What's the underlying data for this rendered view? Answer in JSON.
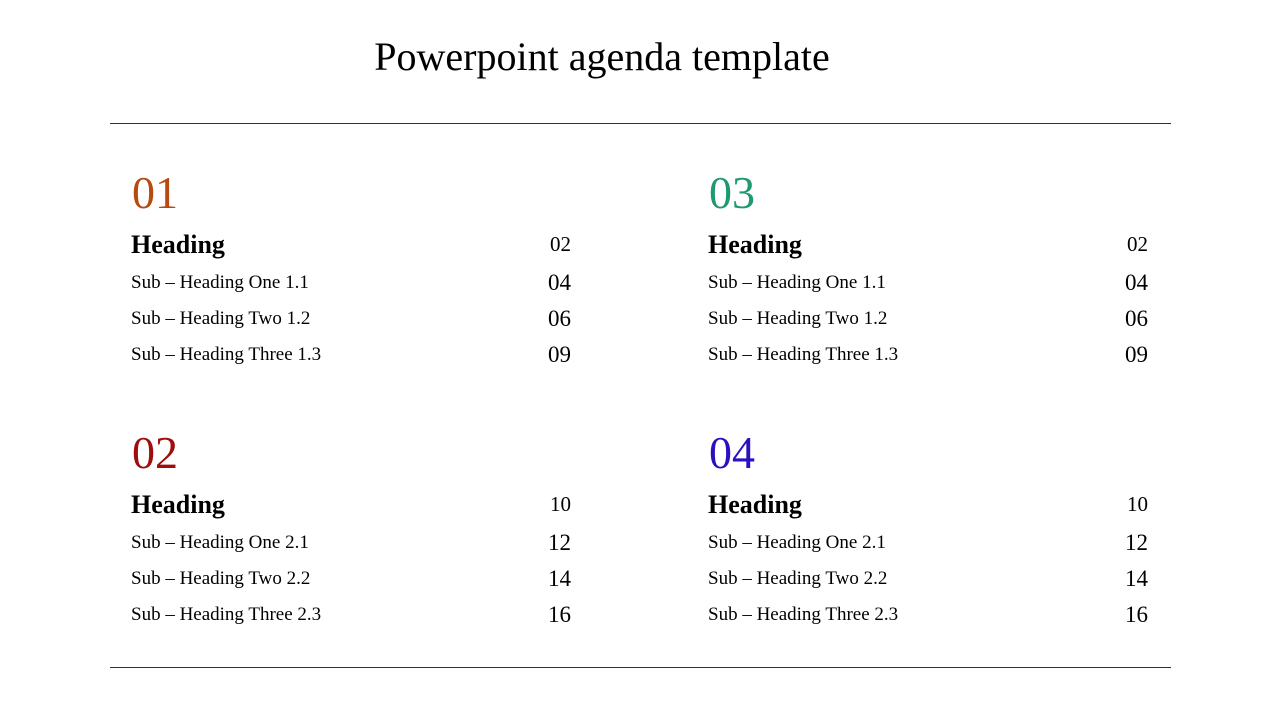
{
  "title": "Powerpoint agenda template",
  "sections": [
    {
      "number": "01",
      "color": "#b84a10",
      "heading": {
        "label": "Heading",
        "page": "02"
      },
      "items": [
        {
          "label": "Sub – Heading One 1.1",
          "page": "04"
        },
        {
          "label": "Sub – Heading Two  1.2",
          "page": "06"
        },
        {
          "label": "Sub – Heading Three 1.3",
          "page": "09"
        }
      ]
    },
    {
      "number": "02",
      "color": "#a00d0d",
      "heading": {
        "label": "Heading",
        "page": "10"
      },
      "items": [
        {
          "label": "Sub – Heading One 2.1",
          "page": "12"
        },
        {
          "label": "Sub – Heading Two  2.2",
          "page": "14"
        },
        {
          "label": "Sub – Heading Three 2.3",
          "page": "16"
        }
      ]
    },
    {
      "number": "03",
      "color": "#1e9a6e",
      "heading": {
        "label": "Heading",
        "page": "02"
      },
      "items": [
        {
          "label": "Sub – Heading One 1.1",
          "page": "04"
        },
        {
          "label": "Sub – Heading Two  1.2",
          "page": "06"
        },
        {
          "label": "Sub – Heading Three 1.3",
          "page": "09"
        }
      ]
    },
    {
      "number": "04",
      "color": "#2b10c0",
      "heading": {
        "label": "Heading",
        "page": "10"
      },
      "items": [
        {
          "label": "Sub – Heading One 2.1",
          "page": "12"
        },
        {
          "label": "Sub – Heading Two  2.2",
          "page": "14"
        },
        {
          "label": "Sub – Heading Three 2.3",
          "page": "16"
        }
      ]
    }
  ]
}
